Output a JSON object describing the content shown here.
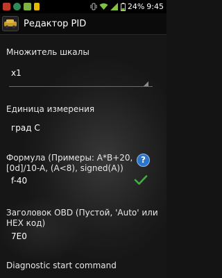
{
  "status_bar": {
    "battery_percent": "24%",
    "time": "9:45"
  },
  "app": {
    "title": "Редактор PID"
  },
  "form": {
    "scale_label": "Множитель шкалы",
    "scale_value": "x1",
    "unit_label": "Единица измерения",
    "unit_value": "град С",
    "formula_label": "Формула (Примеры: A*B+20, [0d]/10-A, (A<8), signed(A))",
    "formula_value": "f-40",
    "obd_header_label": "Заголовок OBD (Пустой, 'Auto' или HEX код)",
    "obd_header_value": "7E0",
    "diag_label": "Diagnostic start command"
  },
  "icons": {
    "help": "help-circle-icon",
    "check": "check-icon"
  },
  "colors": {
    "accent_check": "#3db23d",
    "help_blue": "#2b74c8"
  }
}
